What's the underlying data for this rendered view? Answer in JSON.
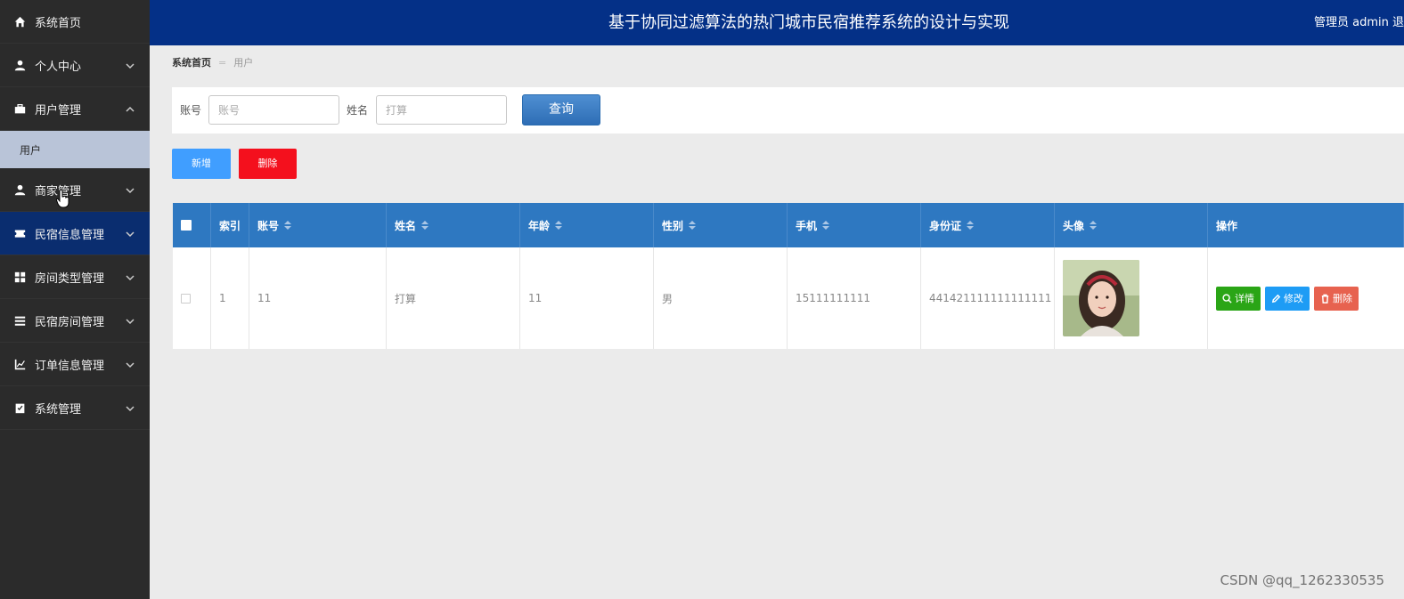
{
  "sidebar": {
    "items": [
      {
        "label": "系统首页",
        "icon": "home-icon"
      },
      {
        "label": "个人中心",
        "icon": "user-icon"
      },
      {
        "label": "用户管理",
        "icon": "briefcase-icon"
      },
      {
        "label": "商家管理",
        "icon": "user-icon"
      },
      {
        "label": "民宿信息管理",
        "icon": "ticket-icon"
      },
      {
        "label": "房间类型管理",
        "icon": "grid-icon"
      },
      {
        "label": "民宿房间管理",
        "icon": "list-icon"
      },
      {
        "label": "订单信息管理",
        "icon": "chart-icon"
      },
      {
        "label": "系统管理",
        "icon": "clipboard-icon"
      }
    ],
    "sub_item": "用户"
  },
  "header": {
    "title": "基于协同过滤算法的热门城市民宿推荐系统的设计与实现",
    "admin": "管理员 admin  退"
  },
  "breadcrumb": {
    "home": "系统首页",
    "current": "用户"
  },
  "search": {
    "account_label": "账号",
    "account_placeholder": "账号",
    "name_label": "姓名",
    "name_placeholder": "打算",
    "query_button": "查询"
  },
  "actions": {
    "add": "新增",
    "delete": "删除"
  },
  "table": {
    "headers": [
      "索引",
      "账号",
      "姓名",
      "年龄",
      "性别",
      "手机",
      "身份证",
      "头像",
      "操作"
    ],
    "rows": [
      {
        "index": "1",
        "account": "11",
        "name": "打算",
        "age": "11",
        "gender": "男",
        "phone": "15111111111",
        "id_card": "441421111111111111",
        "buttons": {
          "detail": "详情",
          "edit": "修改",
          "delete": "删除"
        }
      }
    ]
  },
  "colors": {
    "header_bg": "#043087",
    "sidebar_bg": "#2b2b2b",
    "table_header_bg": "#2e78c1",
    "add_button": "#409eff",
    "delete_button": "#f4101d"
  },
  "watermark": "CSDN @qq_1262330535"
}
